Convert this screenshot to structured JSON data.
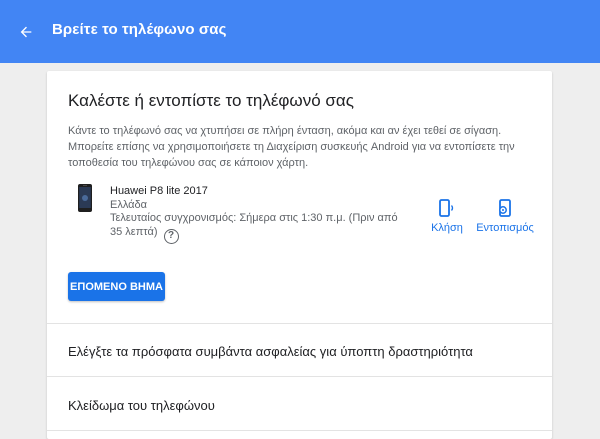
{
  "header": {
    "title": "Βρείτε το τηλέφωνο σας",
    "back_icon": "arrow-back-icon"
  },
  "card": {
    "title": "Καλέστε ή εντοπίστε το τηλέφωνό σας",
    "description": "Κάντε το τηλέφωνό σας να χτυπήσει σε πλήρη ένταση, ακόμα και αν έχει τεθεί σε σίγαση. Μπορείτε επίσης να χρησιμοποιήσετε τη Διαχείριση συσκευής Android για να εντοπίσετε την τοποθεσία του τηλεφώνου σας σε κάποιον χάρτη.",
    "device": {
      "name": "Huawei P8 lite 2017",
      "country": "Ελλάδα",
      "last_sync": "Τελευταίος συγχρονισμός: Σήμερα στις 1:30 π.μ. (Πριν από 35 λεπτά)",
      "help_icon": "help-icon"
    },
    "actions": {
      "call_label": "Κλήση",
      "locate_label": "Εντοπισμός"
    },
    "next_button_label": "ΕΠΟΜΕΝΟ ΒΗΜΑ"
  },
  "rows": [
    {
      "label": "Ελέγξτε τα πρόσφατα συμβάντα ασφαλείας για ύποπτη δραστηριότητα"
    },
    {
      "label": "Κλείδωμα του τηλεφώνου"
    }
  ],
  "colors": {
    "header_bg": "#4285f4",
    "accent": "#1a73e8",
    "page_bg": "#eeeeee"
  }
}
